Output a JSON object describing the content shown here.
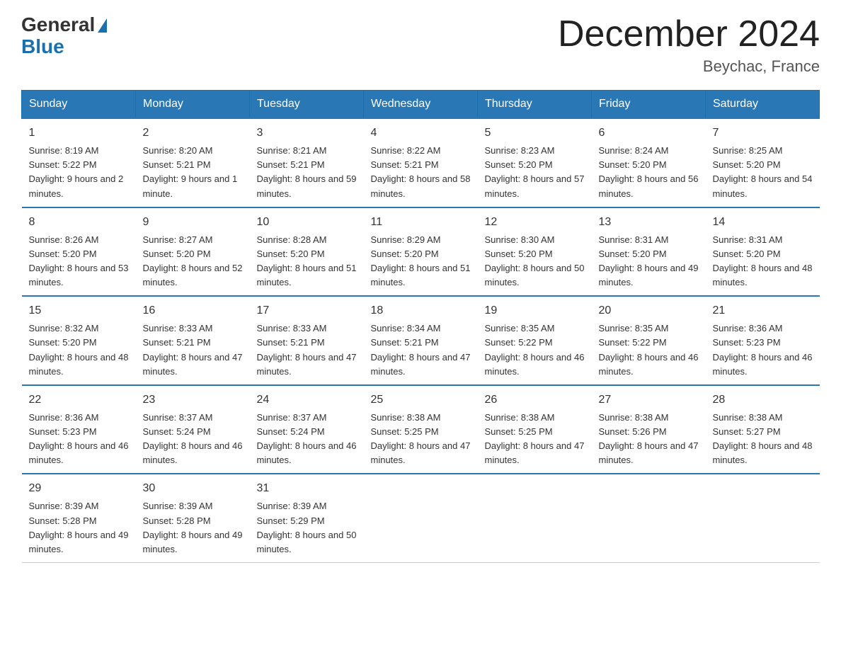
{
  "logo": {
    "general": "General",
    "blue": "Blue"
  },
  "title": "December 2024",
  "location": "Beychac, France",
  "days_of_week": [
    "Sunday",
    "Monday",
    "Tuesday",
    "Wednesday",
    "Thursday",
    "Friday",
    "Saturday"
  ],
  "weeks": [
    [
      {
        "num": "1",
        "sunrise": "8:19 AM",
        "sunset": "5:22 PM",
        "daylight": "9 hours and 2 minutes."
      },
      {
        "num": "2",
        "sunrise": "8:20 AM",
        "sunset": "5:21 PM",
        "daylight": "9 hours and 1 minute."
      },
      {
        "num": "3",
        "sunrise": "8:21 AM",
        "sunset": "5:21 PM",
        "daylight": "8 hours and 59 minutes."
      },
      {
        "num": "4",
        "sunrise": "8:22 AM",
        "sunset": "5:21 PM",
        "daylight": "8 hours and 58 minutes."
      },
      {
        "num": "5",
        "sunrise": "8:23 AM",
        "sunset": "5:20 PM",
        "daylight": "8 hours and 57 minutes."
      },
      {
        "num": "6",
        "sunrise": "8:24 AM",
        "sunset": "5:20 PM",
        "daylight": "8 hours and 56 minutes."
      },
      {
        "num": "7",
        "sunrise": "8:25 AM",
        "sunset": "5:20 PM",
        "daylight": "8 hours and 54 minutes."
      }
    ],
    [
      {
        "num": "8",
        "sunrise": "8:26 AM",
        "sunset": "5:20 PM",
        "daylight": "8 hours and 53 minutes."
      },
      {
        "num": "9",
        "sunrise": "8:27 AM",
        "sunset": "5:20 PM",
        "daylight": "8 hours and 52 minutes."
      },
      {
        "num": "10",
        "sunrise": "8:28 AM",
        "sunset": "5:20 PM",
        "daylight": "8 hours and 51 minutes."
      },
      {
        "num": "11",
        "sunrise": "8:29 AM",
        "sunset": "5:20 PM",
        "daylight": "8 hours and 51 minutes."
      },
      {
        "num": "12",
        "sunrise": "8:30 AM",
        "sunset": "5:20 PM",
        "daylight": "8 hours and 50 minutes."
      },
      {
        "num": "13",
        "sunrise": "8:31 AM",
        "sunset": "5:20 PM",
        "daylight": "8 hours and 49 minutes."
      },
      {
        "num": "14",
        "sunrise": "8:31 AM",
        "sunset": "5:20 PM",
        "daylight": "8 hours and 48 minutes."
      }
    ],
    [
      {
        "num": "15",
        "sunrise": "8:32 AM",
        "sunset": "5:20 PM",
        "daylight": "8 hours and 48 minutes."
      },
      {
        "num": "16",
        "sunrise": "8:33 AM",
        "sunset": "5:21 PM",
        "daylight": "8 hours and 47 minutes."
      },
      {
        "num": "17",
        "sunrise": "8:33 AM",
        "sunset": "5:21 PM",
        "daylight": "8 hours and 47 minutes."
      },
      {
        "num": "18",
        "sunrise": "8:34 AM",
        "sunset": "5:21 PM",
        "daylight": "8 hours and 47 minutes."
      },
      {
        "num": "19",
        "sunrise": "8:35 AM",
        "sunset": "5:22 PM",
        "daylight": "8 hours and 46 minutes."
      },
      {
        "num": "20",
        "sunrise": "8:35 AM",
        "sunset": "5:22 PM",
        "daylight": "8 hours and 46 minutes."
      },
      {
        "num": "21",
        "sunrise": "8:36 AM",
        "sunset": "5:23 PM",
        "daylight": "8 hours and 46 minutes."
      }
    ],
    [
      {
        "num": "22",
        "sunrise": "8:36 AM",
        "sunset": "5:23 PM",
        "daylight": "8 hours and 46 minutes."
      },
      {
        "num": "23",
        "sunrise": "8:37 AM",
        "sunset": "5:24 PM",
        "daylight": "8 hours and 46 minutes."
      },
      {
        "num": "24",
        "sunrise": "8:37 AM",
        "sunset": "5:24 PM",
        "daylight": "8 hours and 46 minutes."
      },
      {
        "num": "25",
        "sunrise": "8:38 AM",
        "sunset": "5:25 PM",
        "daylight": "8 hours and 47 minutes."
      },
      {
        "num": "26",
        "sunrise": "8:38 AM",
        "sunset": "5:25 PM",
        "daylight": "8 hours and 47 minutes."
      },
      {
        "num": "27",
        "sunrise": "8:38 AM",
        "sunset": "5:26 PM",
        "daylight": "8 hours and 47 minutes."
      },
      {
        "num": "28",
        "sunrise": "8:38 AM",
        "sunset": "5:27 PM",
        "daylight": "8 hours and 48 minutes."
      }
    ],
    [
      {
        "num": "29",
        "sunrise": "8:39 AM",
        "sunset": "5:28 PM",
        "daylight": "8 hours and 49 minutes."
      },
      {
        "num": "30",
        "sunrise": "8:39 AM",
        "sunset": "5:28 PM",
        "daylight": "8 hours and 49 minutes."
      },
      {
        "num": "31",
        "sunrise": "8:39 AM",
        "sunset": "5:29 PM",
        "daylight": "8 hours and 50 minutes."
      },
      {
        "num": "",
        "sunrise": "",
        "sunset": "",
        "daylight": ""
      },
      {
        "num": "",
        "sunrise": "",
        "sunset": "",
        "daylight": ""
      },
      {
        "num": "",
        "sunrise": "",
        "sunset": "",
        "daylight": ""
      },
      {
        "num": "",
        "sunrise": "",
        "sunset": "",
        "daylight": ""
      }
    ]
  ],
  "labels": {
    "sunrise": "Sunrise:",
    "sunset": "Sunset:",
    "daylight": "Daylight:"
  }
}
